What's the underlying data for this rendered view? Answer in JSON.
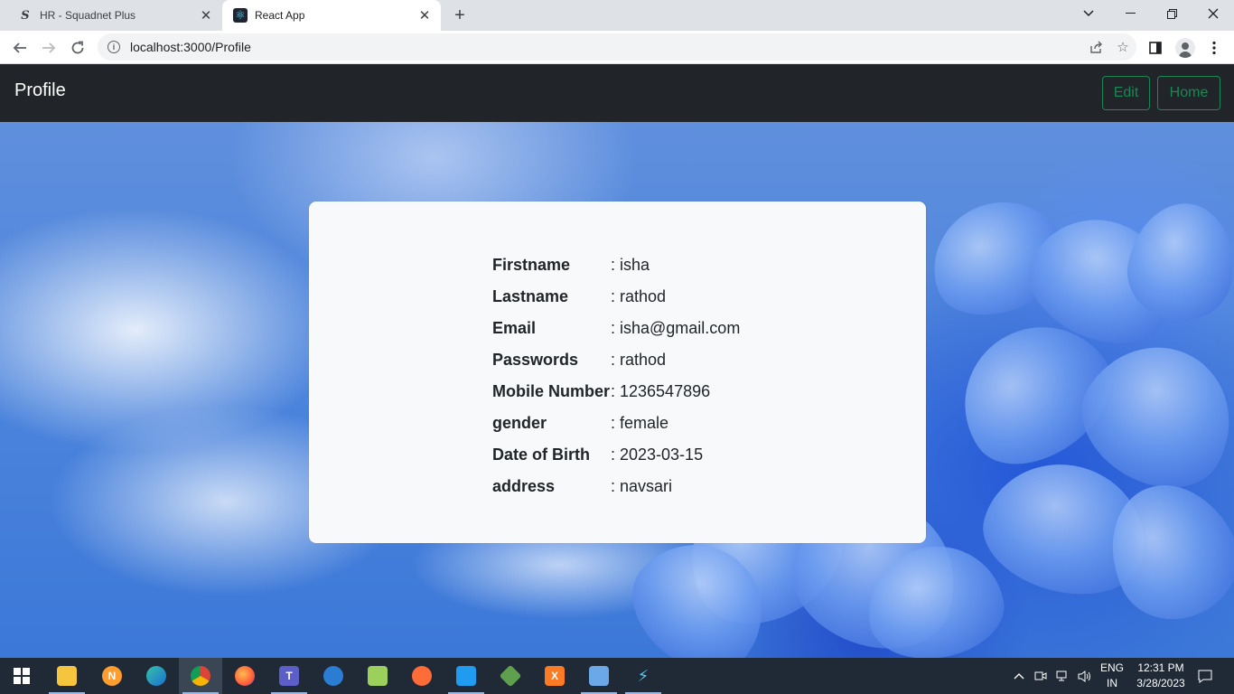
{
  "browser": {
    "tabs": [
      {
        "title": "HR - Squadnet Plus",
        "favicon": "squadnet-icon",
        "active": false
      },
      {
        "title": "React App",
        "favicon": "react-icon",
        "active": true
      }
    ],
    "url": "localhost:3000/Profile"
  },
  "navbar": {
    "brand": "Profile",
    "edit_label": "Edit",
    "home_label": "Home",
    "accent": "#198754",
    "background": "#212529"
  },
  "profile": {
    "rows": [
      {
        "label": "Firstname",
        "value": ": isha"
      },
      {
        "label": "Lastname",
        "value": ": rathod"
      },
      {
        "label": "Email",
        "value": ": isha@gmail.com"
      },
      {
        "label": "Passwords",
        "value": ": rathod"
      },
      {
        "label": "Mobile Number",
        "value": ": 1236547896"
      },
      {
        "label": "gender",
        "value": ": female"
      },
      {
        "label": "Date of Birth",
        "value": ": 2023-03-15"
      },
      {
        "label": "address",
        "value": ": navsari"
      }
    ]
  },
  "taskbar": {
    "apps": [
      "windows-start-icon",
      "file-explorer-icon",
      "nox-icon",
      "edge-icon",
      "chrome-icon",
      "firefox-icon",
      "teams-icon",
      "outlook-icon",
      "notepad-plus-plus-icon",
      "postman-icon",
      "vscode-icon",
      "nodejs-icon",
      "xampp-icon",
      "network-app-icon",
      "azure-data-icon"
    ],
    "language_line1": "ENG",
    "language_line2": "IN",
    "time": "12:31 PM",
    "date": "3/28/2023"
  }
}
